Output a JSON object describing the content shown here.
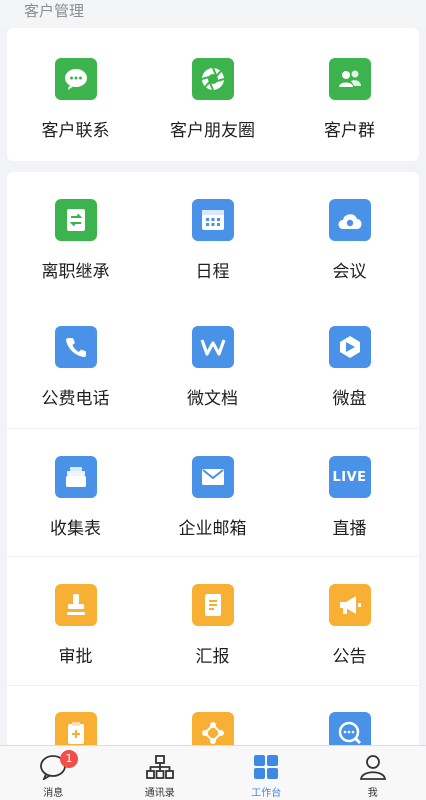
{
  "section": {
    "title": "客户管理"
  },
  "customer": {
    "items": [
      {
        "label": "客户联系",
        "icon": "wechat-chat-icon"
      },
      {
        "label": "客户朋友圈",
        "icon": "moments-shutter-icon"
      },
      {
        "label": "客户群",
        "icon": "group-people-icon"
      }
    ]
  },
  "apps": {
    "items": [
      {
        "label": "离职继承",
        "icon": "transfer-document-icon"
      },
      {
        "label": "日程",
        "icon": "calendar-icon"
      },
      {
        "label": "会议",
        "icon": "cloud-meeting-icon"
      },
      {
        "label": "公费电话",
        "icon": "phone-icon"
      },
      {
        "label": "微文档",
        "icon": "doc-w-icon"
      },
      {
        "label": "微盘",
        "icon": "drive-icon"
      },
      {
        "label": "收集表",
        "icon": "collect-form-icon"
      },
      {
        "label": "企业邮箱",
        "icon": "mail-icon"
      },
      {
        "label": "直播",
        "icon": "live-icon",
        "icon_text": "LIVE"
      },
      {
        "label": "审批",
        "icon": "stamp-icon"
      },
      {
        "label": "汇报",
        "icon": "report-icon"
      },
      {
        "label": "公告",
        "icon": "megaphone-icon"
      },
      {
        "label": "",
        "icon": "clipboard-add-icon"
      },
      {
        "label": "",
        "icon": "network-nodes-icon"
      },
      {
        "label": "",
        "icon": "chat-search-icon"
      }
    ]
  },
  "tabbar": {
    "tabs": [
      {
        "label": "消息",
        "icon": "message-icon",
        "badge": "1"
      },
      {
        "label": "通讯录",
        "icon": "org-chart-icon"
      },
      {
        "label": "工作台",
        "icon": "grid-icon",
        "active": true
      },
      {
        "label": "我",
        "icon": "person-icon"
      }
    ]
  },
  "colors": {
    "green": "#3db34d",
    "blue": "#4a91e8",
    "orange": "#f7b033",
    "accent": "#3d8ae6",
    "badge": "#f0504b"
  }
}
